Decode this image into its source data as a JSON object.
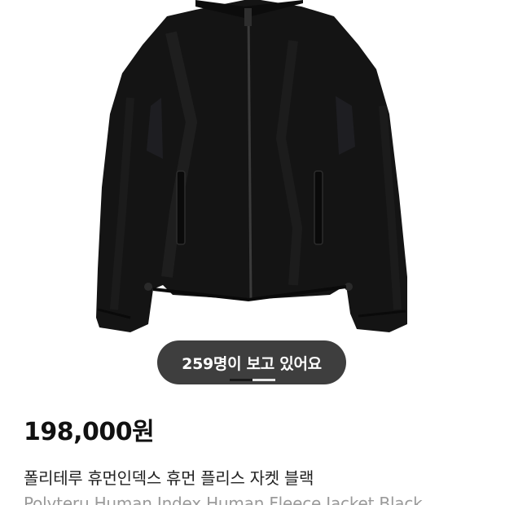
{
  "product": {
    "image_alt": "Polyteru Human Index Human Fleece Jacket Black",
    "viewers_text": "259명이 보고 있어요",
    "price": "198,000원",
    "name_ko": "폴리테루 휴먼인덱스 휴먼 플리스 자켓 블랙",
    "name_en": "Polyteru Human Index Human Fleece Jacket Black"
  },
  "gallery": {
    "page_count": 2,
    "current_page": 1
  },
  "colors": {
    "pill_bg": "#3e3e3e",
    "jacket": "#141414",
    "text_primary": "#111111",
    "text_secondary": "#9a9a9a"
  }
}
